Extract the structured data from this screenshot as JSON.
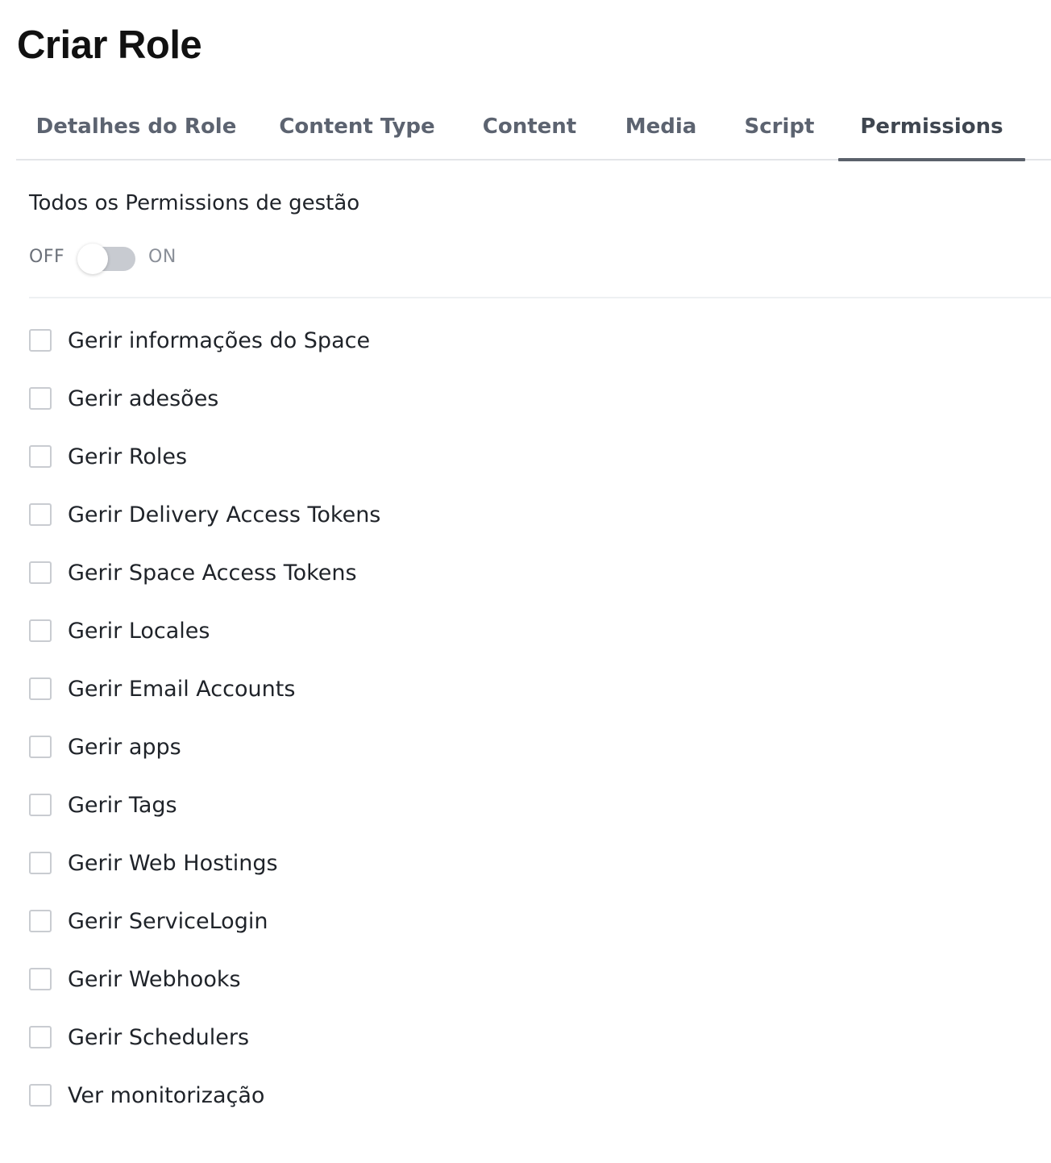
{
  "page": {
    "title": "Criar Role"
  },
  "tabs": [
    {
      "label": "Detalhes do Role",
      "active": false
    },
    {
      "label": "Content Type",
      "active": false
    },
    {
      "label": "Content",
      "active": false
    },
    {
      "label": "Media",
      "active": false
    },
    {
      "label": "Script",
      "active": false
    },
    {
      "label": "Permissions",
      "active": true
    }
  ],
  "management": {
    "title": "Todos os Permissions de gestão",
    "toggle": {
      "off_label": "OFF",
      "on_label": "ON",
      "state": "off"
    }
  },
  "permissions": [
    {
      "label": "Gerir informações do Space",
      "checked": false
    },
    {
      "label": "Gerir adesões",
      "checked": false
    },
    {
      "label": "Gerir Roles",
      "checked": false
    },
    {
      "label": "Gerir Delivery Access Tokens",
      "checked": false
    },
    {
      "label": "Gerir Space Access Tokens",
      "checked": false
    },
    {
      "label": "Gerir Locales",
      "checked": false
    },
    {
      "label": "Gerir Email Accounts",
      "checked": false
    },
    {
      "label": "Gerir apps",
      "checked": false
    },
    {
      "label": "Gerir Tags",
      "checked": false
    },
    {
      "label": "Gerir Web Hostings",
      "checked": false
    },
    {
      "label": "Gerir ServiceLogin",
      "checked": false
    },
    {
      "label": "Gerir Webhooks",
      "checked": false
    },
    {
      "label": "Gerir Schedulers",
      "checked": false
    },
    {
      "label": "Ver monitorização",
      "checked": false
    }
  ],
  "colors": {
    "tab_text": "#5c6370",
    "tab_indicator": "#5b616b",
    "toggle_track": "#c8cbd1",
    "checkbox_border": "#c9ccd1"
  }
}
